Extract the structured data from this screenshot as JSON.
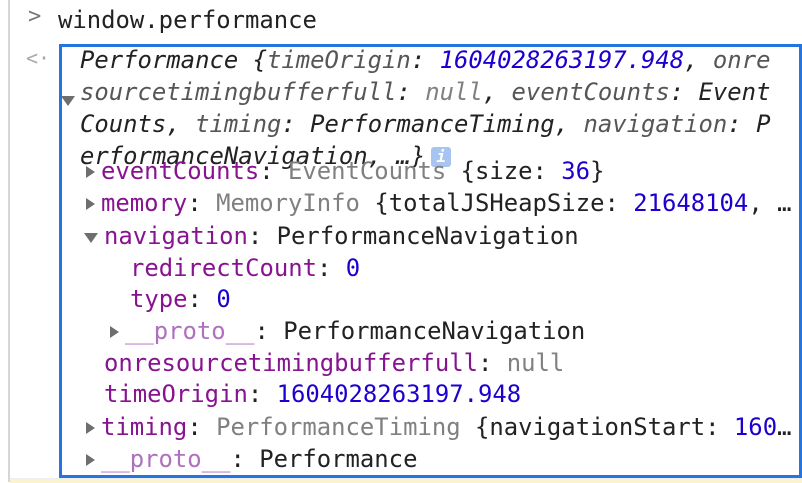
{
  "input": {
    "prompt_icon": "chevron-right-icon",
    "command": "window.performance"
  },
  "output": {
    "return_icon": "return-arrow-icon",
    "preview": [
      {
        "t": "Performance {",
        "c": "b"
      },
      {
        "t": "timeOrigin",
        "c": "k"
      },
      {
        "t": ": ",
        "c": "b"
      },
      {
        "t": "1604028263197.948",
        "c": "n"
      },
      {
        "t": ", ",
        "c": "b"
      },
      {
        "t": "onresourcetimingbufferfull",
        "c": "k"
      },
      {
        "t": ": ",
        "c": "b"
      },
      {
        "t": "null",
        "c": "g"
      },
      {
        "t": ", ",
        "c": "b"
      },
      {
        "t": "eventCounts",
        "c": "k"
      },
      {
        "t": ": EventCounts, ",
        "c": "b"
      },
      {
        "t": "timing",
        "c": "k"
      },
      {
        "t": ": PerformanceTiming, ",
        "c": "b"
      },
      {
        "t": "navigation",
        "c": "k"
      },
      {
        "t": ": PerformanceNavigation, …}",
        "c": "b"
      }
    ],
    "info_badge": "i",
    "props": {
      "eventCounts": {
        "key": "eventCounts",
        "sep": ": ",
        "cls": "EventCounts",
        "rest": " {size: ",
        "num": "36",
        "end": "}"
      },
      "memory": {
        "key": "memory",
        "sep": ": ",
        "cls": "MemoryInfo",
        "rest": " {totalJSHeapSize: ",
        "num": "21648104",
        "end": ", …"
      },
      "navigation": {
        "key": "navigation",
        "sep": ": ",
        "cls": "PerformanceNavigation"
      },
      "redirectCount": {
        "key": "redirectCount",
        "sep": ": ",
        "val": "0"
      },
      "type": {
        "key": "type",
        "sep": ": ",
        "val": "0"
      },
      "nav_proto": {
        "key": "__proto__",
        "sep": ": ",
        "cls": "PerformanceNavigation"
      },
      "onresource": {
        "key": "onresourcetimingbufferfull",
        "sep": ": ",
        "val": "null"
      },
      "timeOrigin": {
        "key": "timeOrigin",
        "sep": ": ",
        "val": "1604028263197.948"
      },
      "timing": {
        "key": "timing",
        "sep": ": ",
        "cls": "PerformanceTiming",
        "rest": " {navigationStart: ",
        "num": "160",
        "end": "…"
      },
      "proto": {
        "key": "__proto__",
        "sep": ": ",
        "cls": "Performance"
      }
    }
  },
  "colors": {
    "highlight_border": "#2475e0",
    "property": "#881391",
    "number": "#1c00cf",
    "null": "#808080"
  }
}
